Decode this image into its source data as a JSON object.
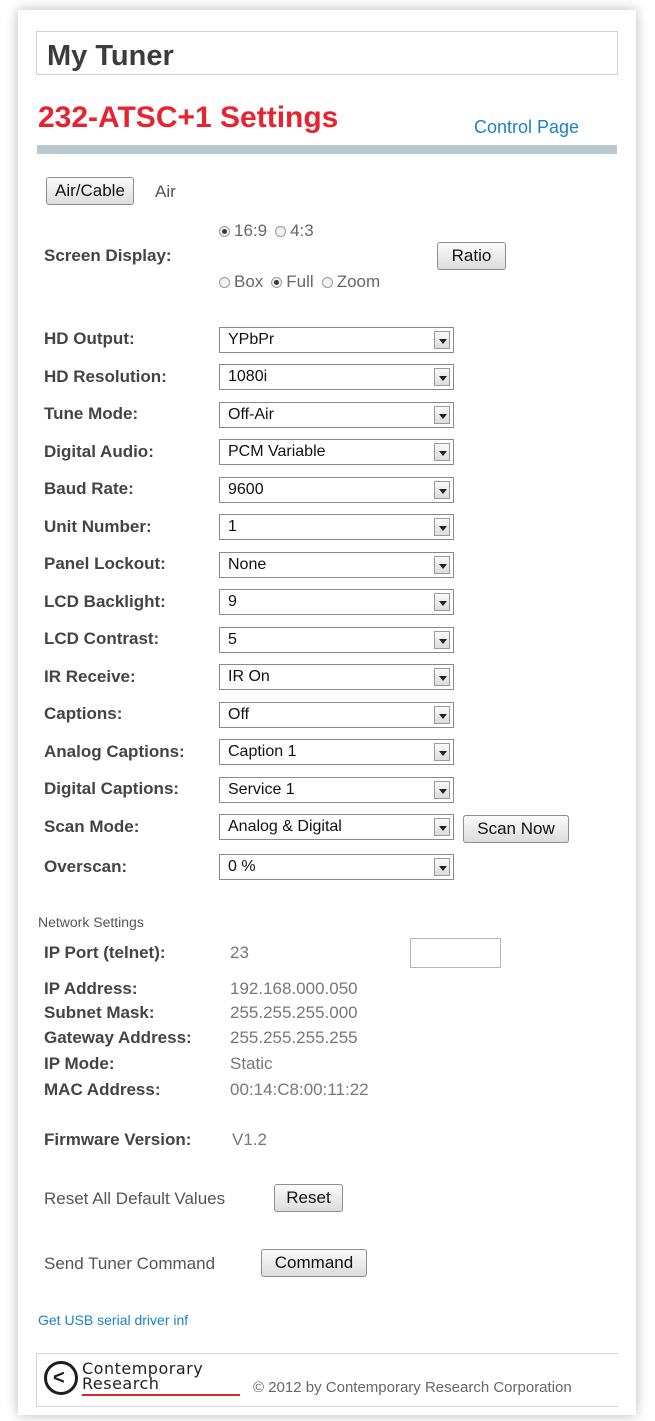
{
  "app_title": "My Tuner",
  "page_heading": "232-ATSC+1 Settings",
  "control_page_link": "Control Page",
  "air_cable": {
    "button_label": "Air/Cable",
    "value": "Air"
  },
  "screen_display": {
    "label": "Screen Display:",
    "aspect_options": [
      {
        "label": "16:9",
        "selected": true
      },
      {
        "label": "4:3",
        "selected": false
      }
    ],
    "mode_options": [
      {
        "label": "Box",
        "selected": false
      },
      {
        "label": "Full",
        "selected": true
      },
      {
        "label": "Zoom",
        "selected": false
      }
    ],
    "ratio_button": "Ratio"
  },
  "settings": [
    {
      "label": "HD Output:",
      "value": "YPbPr"
    },
    {
      "label": "HD Resolution:",
      "value": "1080i"
    },
    {
      "label": "Tune Mode:",
      "value": "Off-Air"
    },
    {
      "label": "Digital Audio:",
      "value": "PCM Variable"
    },
    {
      "label": "Baud Rate:",
      "value": "9600"
    },
    {
      "label": "Unit Number:",
      "value": "1"
    },
    {
      "label": "Panel Lockout:",
      "value": "None"
    },
    {
      "label": "LCD Backlight:",
      "value": "9"
    },
    {
      "label": "LCD Contrast:",
      "value": "5"
    },
    {
      "label": "IR Receive:",
      "value": "IR On"
    },
    {
      "label": "Captions:",
      "value": "Off"
    },
    {
      "label": "Analog Captions:",
      "value": "Caption 1"
    },
    {
      "label": "Digital Captions:",
      "value": "Service 1"
    },
    {
      "label": "Scan Mode:",
      "value": "Analog & Digital"
    },
    {
      "label": "Overscan:",
      "value": "0 %"
    }
  ],
  "scan_now_button": "Scan Now",
  "network": {
    "title": "Network Settings",
    "rows": [
      {
        "label": "IP Port (telnet):",
        "value": "23"
      },
      {
        "label": "IP Address:",
        "value": "192.168.000.050"
      },
      {
        "label": "Subnet Mask:",
        "value": "255.255.255.000"
      },
      {
        "label": "Gateway Address:",
        "value": "255.255.255.255"
      },
      {
        "label": "IP Mode:",
        "value": "Static"
      },
      {
        "label": "MAC Address:",
        "value": "00:14:C8:00:11:22"
      }
    ],
    "port_input_value": ""
  },
  "firmware": {
    "label": "Firmware Version:",
    "value": "V1.2"
  },
  "reset": {
    "text": "Reset All Default Values",
    "button": "Reset"
  },
  "command": {
    "text": "Send Tuner Command",
    "button": "Command"
  },
  "usb_link": "Get USB serial driver inf",
  "footer": {
    "logo_line1": "Contemporary",
    "logo_line2": "Research",
    "copyright": "© 2012 by Contemporary Research Corporation"
  },
  "colors": {
    "heading": "#e8232f",
    "link": "#1a82c8",
    "bar": "#b9c9cd"
  }
}
